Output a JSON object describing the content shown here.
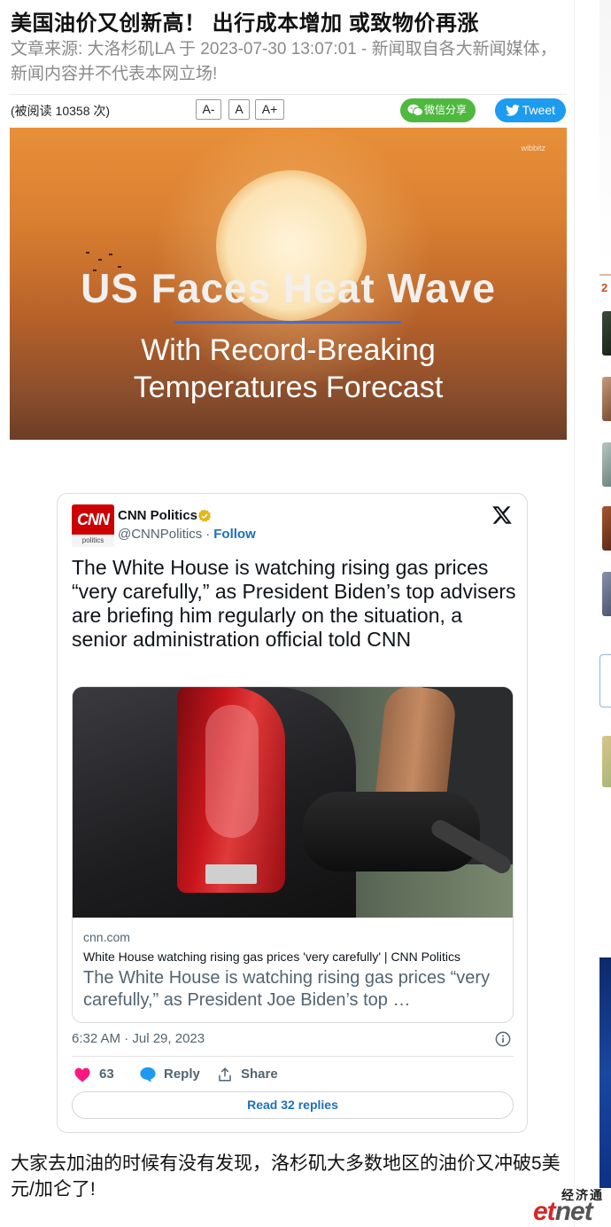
{
  "article": {
    "title": "美国油价又创新高！ 出行成本增加 或致物价再涨",
    "meta": "文章来源: 大洛杉矶LA 于 2023-07-30 13:07:01 - 新闻取自各大新闻媒体，新闻内容并不代表本网立场!",
    "read_count": "(被阅读 10358 次)",
    "font_decrease": "A-",
    "font_reset": "A",
    "font_increase": "A+",
    "wechat_share": "微信分享",
    "tweet_button": "Tweet",
    "body": "大家去加油的时候有没有发现，洛杉矶大多数地区的油价又冲破5美元/加仑了!"
  },
  "hero_image": {
    "watermark": "wibbitz",
    "headline": "US Faces Heat Wave",
    "subline_1": "With Record-Breaking",
    "subline_2": "Temperatures Forecast"
  },
  "tweet": {
    "avatar_logo": "CNN",
    "avatar_sub": "politics",
    "account_name": "CNN Politics",
    "handle": "@CNNPolitics",
    "separator": "·",
    "follow": "Follow",
    "text": "The White House is watching rising gas prices “very carefully,” as President Biden’s top advisers are briefing him regularly on the situation, a senior administration official told CNN",
    "link_domain": "cnn.com",
    "link_title": "White House watching rising gas prices 'very carefully' | CNN Politics",
    "link_description": "The White House is watching rising gas prices “very carefully,” as President Joe Biden’s top …",
    "timestamp": "6:32 AM · Jul 29, 2023",
    "likes": "63",
    "reply": "Reply",
    "share": "Share",
    "read_replies": "Read 32 replies"
  },
  "sidebar": {
    "rank_number": "2"
  },
  "logo": {
    "zh": "经济通",
    "en_a": "et",
    "en_b": "net"
  },
  "colors": {
    "wechat": "#4fb83f",
    "twitter_blue": "#1d9bf0",
    "cnn_red": "#cc0000",
    "like_pink": "#f91880",
    "hero_orange": "#d97f31"
  }
}
